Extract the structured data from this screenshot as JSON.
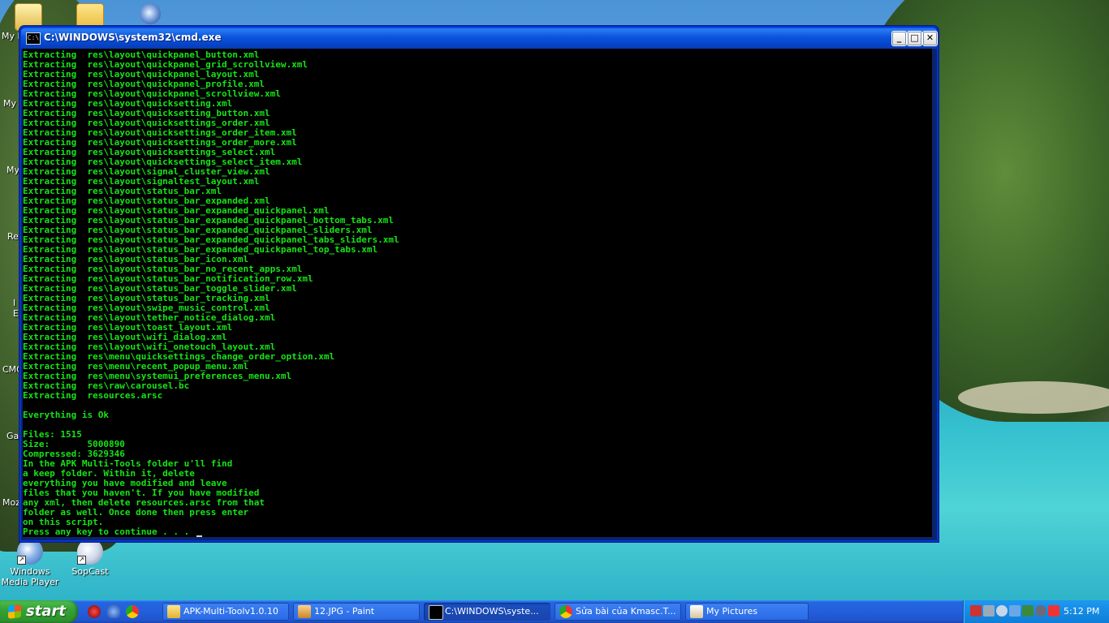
{
  "desktop": {
    "icons": [
      {
        "label": "My Documents"
      },
      {
        "label": "Windows Media Player"
      },
      {
        "label": "SopCast"
      }
    ],
    "edge_labels": [
      "My D",
      "My",
      "My",
      "Re",
      "I",
      "E",
      "CMC",
      "Ga",
      "Moz"
    ]
  },
  "window": {
    "title": "C:\\WINDOWS\\system32\\cmd.exe",
    "icon": "cmd-icon",
    "buttons": {
      "minimize": "_",
      "maximize": "□",
      "close": "✕"
    },
    "console_lines": [
      "Extracting  res\\layout\\quickpanel_button.xml",
      "Extracting  res\\layout\\quickpanel_grid_scrollview.xml",
      "Extracting  res\\layout\\quickpanel_layout.xml",
      "Extracting  res\\layout\\quickpanel_profile.xml",
      "Extracting  res\\layout\\quickpanel_scrollview.xml",
      "Extracting  res\\layout\\quicksetting.xml",
      "Extracting  res\\layout\\quicksetting_button.xml",
      "Extracting  res\\layout\\quicksettings_order.xml",
      "Extracting  res\\layout\\quicksettings_order_item.xml",
      "Extracting  res\\layout\\quicksettings_order_more.xml",
      "Extracting  res\\layout\\quicksettings_select.xml",
      "Extracting  res\\layout\\quicksettings_select_item.xml",
      "Extracting  res\\layout\\signal_cluster_view.xml",
      "Extracting  res\\layout\\signaltest_layout.xml",
      "Extracting  res\\layout\\status_bar.xml",
      "Extracting  res\\layout\\status_bar_expanded.xml",
      "Extracting  res\\layout\\status_bar_expanded_quickpanel.xml",
      "Extracting  res\\layout\\status_bar_expanded_quickpanel_bottom_tabs.xml",
      "Extracting  res\\layout\\status_bar_expanded_quickpanel_sliders.xml",
      "Extracting  res\\layout\\status_bar_expanded_quickpanel_tabs_sliders.xml",
      "Extracting  res\\layout\\status_bar_expanded_quickpanel_top_tabs.xml",
      "Extracting  res\\layout\\status_bar_icon.xml",
      "Extracting  res\\layout\\status_bar_no_recent_apps.xml",
      "Extracting  res\\layout\\status_bar_notification_row.xml",
      "Extracting  res\\layout\\status_bar_toggle_slider.xml",
      "Extracting  res\\layout\\status_bar_tracking.xml",
      "Extracting  res\\layout\\swipe_music_control.xml",
      "Extracting  res\\layout\\tether_notice_dialog.xml",
      "Extracting  res\\layout\\toast_layout.xml",
      "Extracting  res\\layout\\wifi_dialog.xml",
      "Extracting  res\\layout\\wifi_onetouch_layout.xml",
      "Extracting  res\\menu\\quicksettings_change_order_option.xml",
      "Extracting  res\\menu\\recent_popup_menu.xml",
      "Extracting  res\\menu\\systemui_preferences_menu.xml",
      "Extracting  res\\raw\\carousel.bc",
      "Extracting  resources.arsc",
      "",
      "Everything is Ok",
      "",
      "Files: 1515",
      "Size:       5000890",
      "Compressed: 3629346",
      "In the APK Multi-Tools folder u'll find",
      "a keep folder. Within it, delete",
      "everything you have modified and leave",
      "files that you haven't. If you have modified",
      "any xml, then delete resources.arsc from that",
      "folder as well. Once done then press enter",
      "on this script.",
      "Press any key to continue . . . "
    ]
  },
  "taskbar": {
    "start_label": "start",
    "tasks": [
      {
        "label": "APK-Multi-Toolv1.0.10",
        "icon": "folder-icon",
        "active": false
      },
      {
        "label": "12.JPG - Paint",
        "icon": "paint-icon",
        "active": false
      },
      {
        "label": "C:\\WINDOWS\\syste...",
        "icon": "cmd-icon",
        "active": true
      },
      {
        "label": "Sửa bài của Kmasc.T...",
        "icon": "chrome-icon",
        "active": false
      },
      {
        "label": "My Pictures",
        "icon": "pictures-icon",
        "active": false
      }
    ],
    "clock": "5:12 PM"
  }
}
